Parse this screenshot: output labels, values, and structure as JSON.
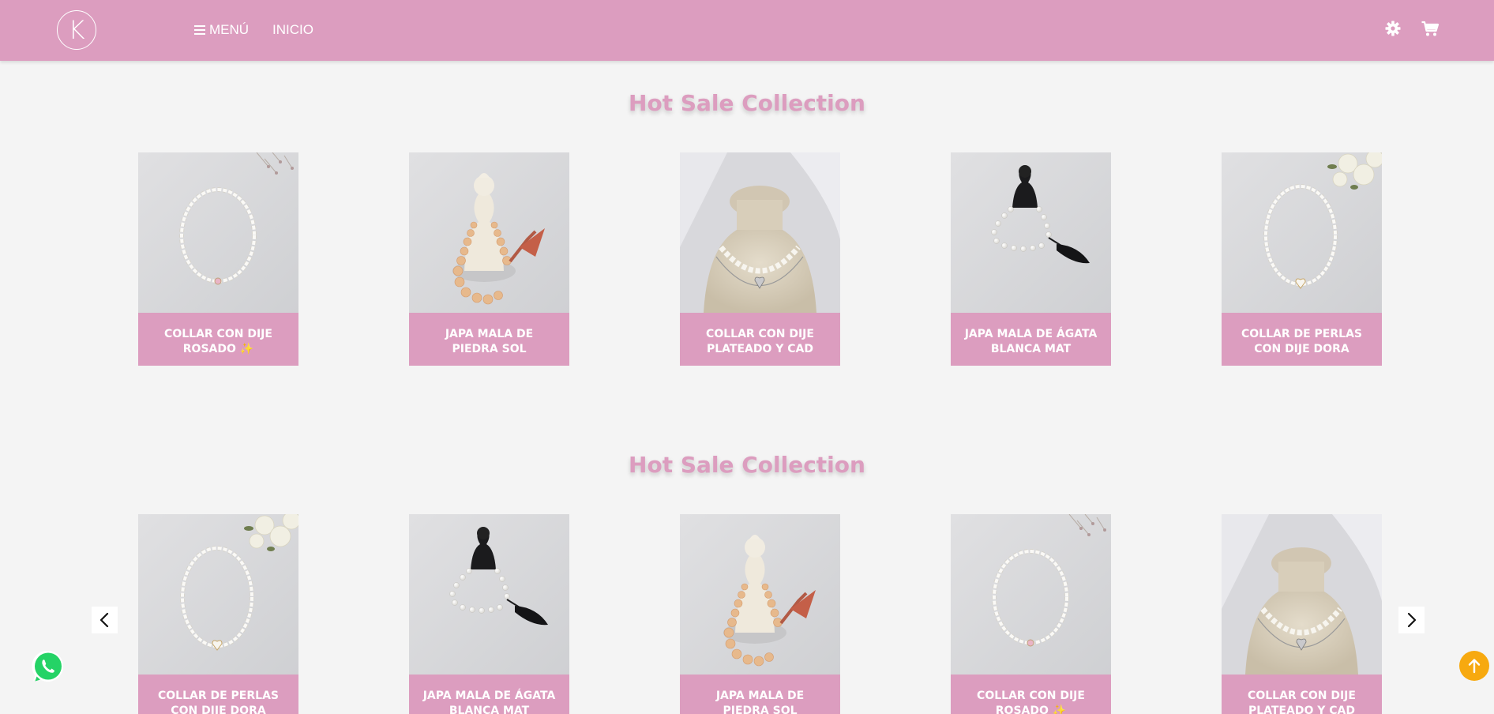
{
  "header": {
    "logo_letter": "K",
    "menu_label": "MENÚ",
    "home_label": "INICIO"
  },
  "sections": [
    {
      "title": "Hot Sale Collection",
      "products": [
        {
          "name": "COLLAR CON DIJE ROSADO ✨",
          "image": "pearl-necklace-pink-charm"
        },
        {
          "name": "JAPA MALA DE PIEDRA SOL",
          "image": "sunstone-japa-mala-buddha"
        },
        {
          "name": "COLLAR CON DIJE PLATEADO Y CAD",
          "image": "pearl-necklace-bust-silver-heart"
        },
        {
          "name": "JAPA MALA DE ÁGATA BLANCA MAT",
          "image": "white-agate-japa-mala-black-buddha"
        },
        {
          "name": "COLLAR DE PERLAS CON DIJE DORA",
          "image": "pearl-necklace-flowers"
        }
      ]
    },
    {
      "title": "Hot Sale Collection",
      "products": [
        {
          "name": "COLLAR DE PERLAS CON DIJE DORA",
          "image": "pearl-necklace-flowers"
        },
        {
          "name": "JAPA MALA DE ÁGATA BLANCA MAT",
          "image": "white-agate-japa-mala-black-buddha"
        },
        {
          "name": "JAPA MALA DE PIEDRA SOL",
          "image": "sunstone-japa-mala-buddha"
        },
        {
          "name": "COLLAR CON DIJE ROSADO ✨",
          "image": "pearl-necklace-pink-charm"
        },
        {
          "name": "COLLAR CON DIJE PLATEADO Y CAD",
          "image": "pearl-necklace-bust-silver-heart"
        }
      ]
    }
  ],
  "icons": {
    "settings": "gear-icon",
    "cart": "cart-icon",
    "whatsapp": "whatsapp-icon",
    "back_to_top": "arrow-up-icon",
    "prev": "chevron-left-icon",
    "next": "chevron-right-icon"
  },
  "colors": {
    "brand_pink": "#dc9dbf",
    "background": "#f4f4f4",
    "back_to_top": "#f7a90f",
    "whatsapp_green": "#25d366"
  }
}
